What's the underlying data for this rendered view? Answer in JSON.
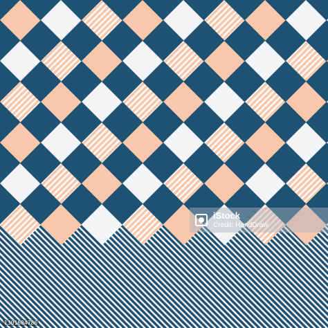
{
  "image": {
    "colors": {
      "navy": "#1e5172",
      "peach": "#f9c7ab",
      "white": "#f3f4f6",
      "stripe_light": "#ffffff"
    },
    "pattern": "diagonal-gingham-plaid"
  },
  "watermark": {
    "brand": "iStock",
    "credit": "Credit: HandDraw"
  },
  "stock_id": "1301684786"
}
